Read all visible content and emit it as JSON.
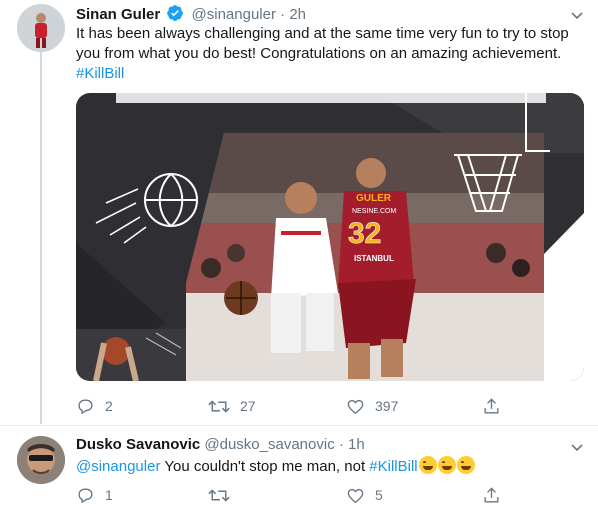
{
  "tweet1": {
    "author_name": "Sinan Guler",
    "handle": "@sinanguler",
    "separator": "·",
    "time": "2h",
    "text": "It has been always challenging and at the same time very fun to try to stop you from what you do best! Congratulations on an amazing achievement.",
    "hashtag": "#KillBill",
    "media": {
      "banner_text": "",
      "jersey_front": "GULER",
      "jersey_sponsor": "NESINE.COM",
      "jersey_number": "32",
      "jersey_city": "ISTANBUL"
    },
    "actions": {
      "reply_count": "2",
      "retweet_count": "27",
      "like_count": "397"
    }
  },
  "tweet2": {
    "author_name": "Dusko Savanovic",
    "handle": "@dusko_savanovic",
    "separator": "·",
    "time": "1h",
    "mention": "@sinanguler",
    "text": " You couldn't stop me man, not ",
    "hashtag": "#KillBill",
    "emoji": "face-with-tears-of-joy",
    "actions": {
      "reply_count": "1",
      "retweet_count": "",
      "like_count": "5"
    }
  },
  "colors": {
    "link": "#1b95e0",
    "verified": "#1da1f2",
    "muted": "#657786",
    "jersey_red": "#a31d2c",
    "jersey_yellow": "#f3b31a"
  }
}
